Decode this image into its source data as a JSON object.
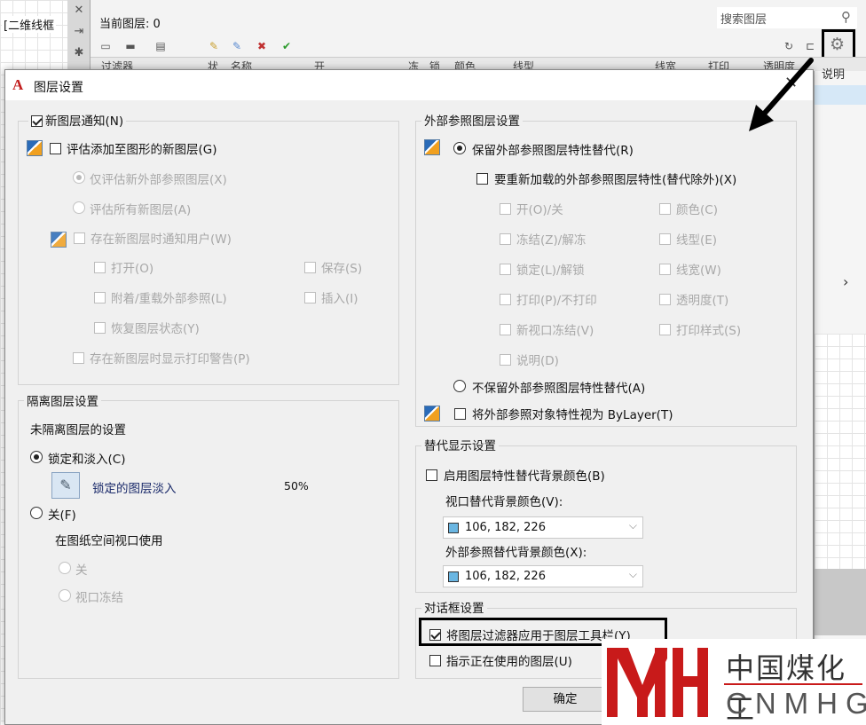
{
  "background": {
    "viewport_label": "[二维线框",
    "current_layer": "当前图层: 0",
    "search_placeholder": "搜索图层",
    "table_headers": [
      "过滤器",
      "状",
      "名称",
      "开",
      "冻",
      "锁",
      "颜色",
      "线型",
      "线宽",
      "打印",
      "透明度"
    ],
    "right_column_header": "说明"
  },
  "dialog": {
    "title": "图层设置",
    "new_layer_notify": {
      "title": "新图层通知(N)",
      "evaluate_new": "评估添加至图形的新图层(G)",
      "only_xref": "仅评估新外部参照图层(X)",
      "all_new": "评估所有新图层(A)",
      "notify_user": "存在新图层时通知用户(W)",
      "open": "打开(O)",
      "save": "保存(S)",
      "attach_reload": "附着/重载外部参照(L)",
      "insert": "插入(I)",
      "restore_state": "恢复图层状态(Y)",
      "plot_warning": "存在新图层时显示打印警告(P)"
    },
    "isolate": {
      "title": "隔离图层设置",
      "unisolated_label": "未隔离图层的设置",
      "lock_fade": "锁定和淡入(C)",
      "locked_fade_label": "锁定的图层淡入",
      "locked_fade_value": "50%",
      "off": "关(F)",
      "paper_space_label": "在图纸空间视口使用",
      "ps_off": "关",
      "ps_vp_freeze": "视口冻结"
    },
    "xref": {
      "title": "外部参照图层设置",
      "retain": "保留外部参照图层特性替代(R)",
      "reload": "要重新加载的外部参照图层特性(替代除外)(X)",
      "props_left": [
        "开(O)/关",
        "冻结(Z)/解冻",
        "锁定(L)/解锁",
        "打印(P)/不打印",
        "新视口冻结(V)",
        "说明(D)"
      ],
      "props_right": [
        "颜色(C)",
        "线型(E)",
        "线宽(W)",
        "透明度(T)",
        "打印样式(S)"
      ],
      "no_retain": "不保留外部参照图层特性替代(A)",
      "bylayer": "将外部参照对象特性视为 ByLayer(T)"
    },
    "override_display": {
      "title": "替代显示设置",
      "enable_bg": "启用图层特性替代背景颜色(B)",
      "vp_bg_label": "视口替代背景颜色(V):",
      "vp_bg_value": "106, 182, 226",
      "xref_bg_label": "外部参照替代背景颜色(X):",
      "xref_bg_value": "106, 182, 226",
      "swatch_color": "#6ab6e2"
    },
    "dialog_settings": {
      "title": "对话框设置",
      "apply_filter": "将图层过滤器应用于图层工具栏(Y)",
      "indicate_in_use": "指示正在使用的图层(U)"
    },
    "ok_button": "确定"
  },
  "watermark": {
    "logo": "MH",
    "cn": "中国煤化工",
    "en": "CNMHG"
  }
}
